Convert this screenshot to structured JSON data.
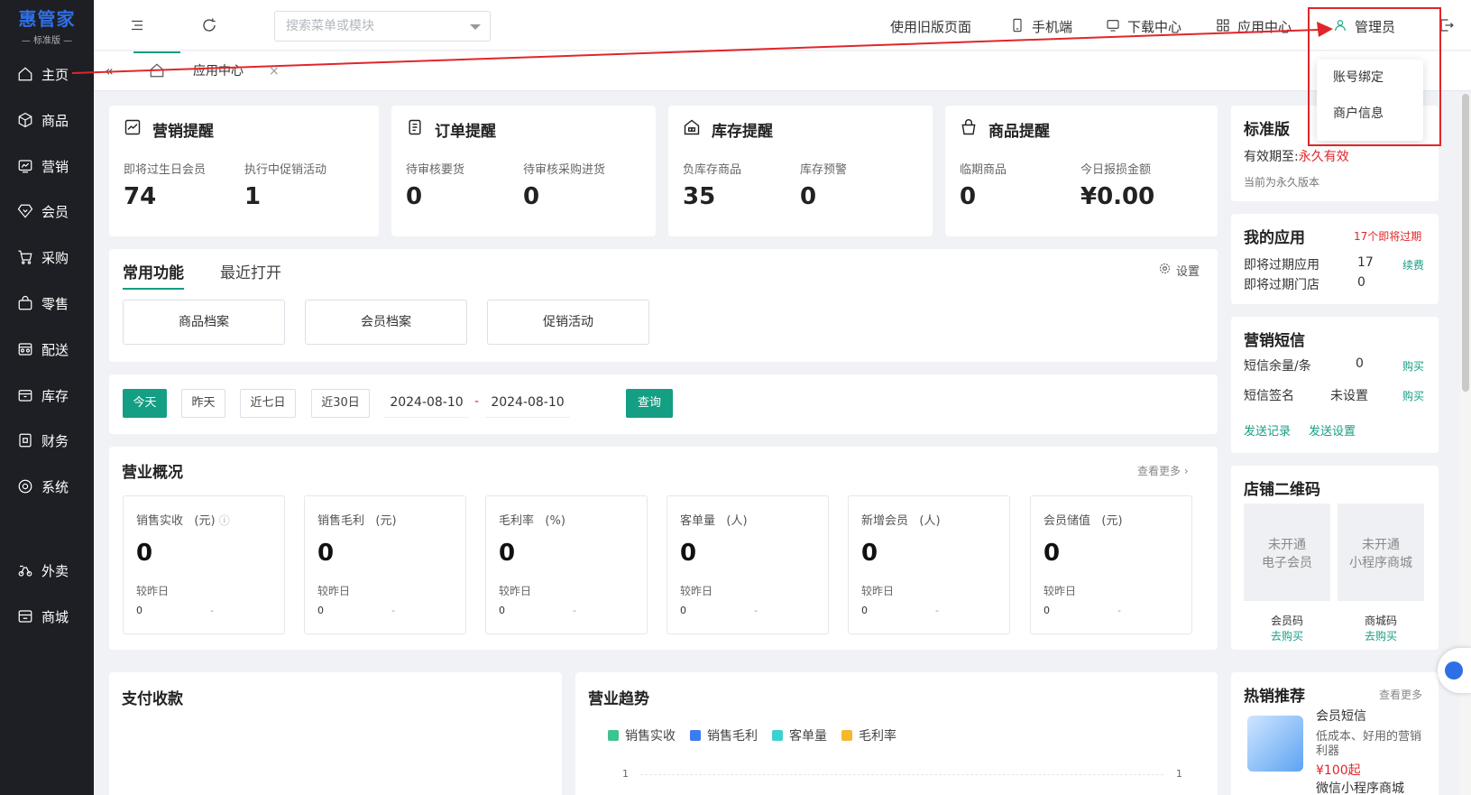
{
  "sidebar": {
    "logo": "惠管家",
    "edition": "— 标准版 —",
    "items": [
      {
        "label": "主页",
        "icon": "home-icon"
      },
      {
        "label": "商品",
        "icon": "box-icon"
      },
      {
        "label": "营销",
        "icon": "chart-icon"
      },
      {
        "label": "会员",
        "icon": "diamond-icon"
      },
      {
        "label": "采购",
        "icon": "cart-icon"
      },
      {
        "label": "零售",
        "icon": "bag-icon"
      },
      {
        "label": "配送",
        "icon": "truck-icon"
      },
      {
        "label": "库存",
        "icon": "inventory-icon"
      },
      {
        "label": "财务",
        "icon": "finance-icon"
      },
      {
        "label": "系统",
        "icon": "settings-icon"
      },
      {
        "label": "外卖",
        "icon": "scooter-icon"
      },
      {
        "label": "商城",
        "icon": "store-icon"
      }
    ]
  },
  "topbar": {
    "search_placeholder": "搜索菜单或模块",
    "old_page": "使用旧版页面",
    "mobile": "手机端",
    "download": "下载中心",
    "app_center": "应用中心",
    "admin": "管理员"
  },
  "dropdown": {
    "items": [
      "账号绑定",
      "商户信息"
    ]
  },
  "tabs": {
    "app_center": "应用中心",
    "close": "×"
  },
  "reminders": [
    {
      "title": "营销提醒",
      "icon": "trend-icon",
      "labels": [
        "即将过生日会员",
        "执行中促销活动"
      ],
      "values": [
        "74",
        "1"
      ]
    },
    {
      "title": "订单提醒",
      "icon": "document-icon",
      "labels": [
        "待审核要货",
        "待审核采购进货"
      ],
      "values": [
        "0",
        "0"
      ]
    },
    {
      "title": "库存提醒",
      "icon": "warehouse-icon",
      "labels": [
        "负库存商品",
        "库存预警"
      ],
      "values": [
        "35",
        "0"
      ]
    },
    {
      "title": "商品提醒",
      "icon": "basket-icon",
      "labels": [
        "临期商品",
        "今日报损金额"
      ],
      "values": [
        "0",
        "¥0.00"
      ]
    }
  ],
  "functions": {
    "tabs": [
      "常用功能",
      "最近打开"
    ],
    "settings": "设置",
    "buttons": [
      "商品档案",
      "会员档案",
      "促销活动"
    ]
  },
  "date_filter": {
    "buttons": [
      "今天",
      "昨天",
      "近七日",
      "近30日"
    ],
    "start": "2024-08-10",
    "end": "2024-08-10",
    "sep": "-",
    "query": "查询"
  },
  "overview": {
    "title": "营业概况",
    "more": "查看更多",
    "compare_label": "较昨日",
    "cards": [
      {
        "label": "销售实收",
        "unit": "(元)",
        "value": "0",
        "cmp": "0",
        "delta": "-"
      },
      {
        "label": "销售毛利",
        "unit": "(元)",
        "value": "0",
        "cmp": "0",
        "delta": "-"
      },
      {
        "label": "毛利率",
        "unit": "(%)",
        "value": "0",
        "cmp": "0",
        "delta": "-"
      },
      {
        "label": "客单量",
        "unit": "(人)",
        "value": "0",
        "cmp": "0",
        "delta": "-"
      },
      {
        "label": "新增会员",
        "unit": "(人)",
        "value": "0",
        "cmp": "0",
        "delta": "-"
      },
      {
        "label": "会员储值",
        "unit": "(元)",
        "value": "0",
        "cmp": "0",
        "delta": "-"
      }
    ]
  },
  "payment": {
    "title": "支付收款"
  },
  "trend": {
    "title": "营业趋势",
    "legend": [
      {
        "name": "销售实收",
        "color": "#3cc48e"
      },
      {
        "name": "销售毛利",
        "color": "#3d7cf0"
      },
      {
        "name": "客单量",
        "color": "#3cd1d1"
      },
      {
        "name": "毛利率",
        "color": "#f5b82e"
      }
    ],
    "y_left": "1",
    "y_right": "1"
  },
  "right": {
    "edition": {
      "title": "标准版",
      "valid_label": "有效期至:",
      "valid_value": "永久有效",
      "note": "当前为永久版本"
    },
    "apps": {
      "title": "我的应用",
      "expiring": "17个即将过期",
      "row1_label": "即将过期应用",
      "row1_value": "17",
      "row1_action": "续费",
      "row2_label": "即将过期门店",
      "row2_value": "0"
    },
    "sms": {
      "title": "营销短信",
      "row1_label": "短信余量/条",
      "row1_value": "0",
      "row1_action": "购买",
      "row2_label": "短信签名",
      "row2_value": "未设置",
      "row2_action": "购买",
      "link1": "发送记录",
      "link2": "发送设置"
    },
    "qrcode": {
      "title": "店铺二维码",
      "left_lines": [
        "未开通",
        "电子会员"
      ],
      "right_lines": [
        "未开通",
        "小程序商城"
      ],
      "left_label": "会员码",
      "left_action": "去购买",
      "right_label": "商城码",
      "right_action": "去购买"
    },
    "hot": {
      "title": "热销推荐",
      "more": "查看更多",
      "item1_title": "会员短信",
      "item1_desc1": "低成本、好用的营销",
      "item1_desc2": "利器",
      "item1_price": "¥100起",
      "item2_title": "微信小程序商城"
    }
  },
  "colors": {
    "accent": "#149e83",
    "highlight": "#e0262a",
    "sidebar": "#1d1f24"
  }
}
